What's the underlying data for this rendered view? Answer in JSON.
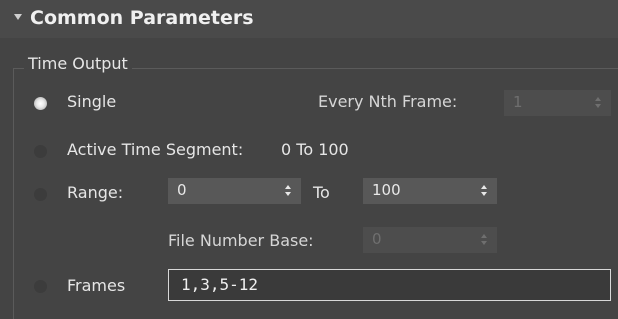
{
  "rollout": {
    "title": "Common Parameters",
    "expanded": true
  },
  "time_output": {
    "group_label": "Time Output",
    "selected": "single",
    "single": {
      "label": "Single"
    },
    "every_nth_frame": {
      "label": "Every Nth Frame:",
      "value": "1",
      "enabled": false
    },
    "active_time_segment": {
      "label": "Active Time Segment:",
      "value": "0 To 100"
    },
    "range": {
      "label": "Range:",
      "from": "0",
      "to_label": "To",
      "to": "100"
    },
    "file_number_base": {
      "label": "File Number Base:",
      "value": "0",
      "enabled": false
    },
    "frames": {
      "label": "Frames",
      "value": "1,3,5-12"
    }
  }
}
